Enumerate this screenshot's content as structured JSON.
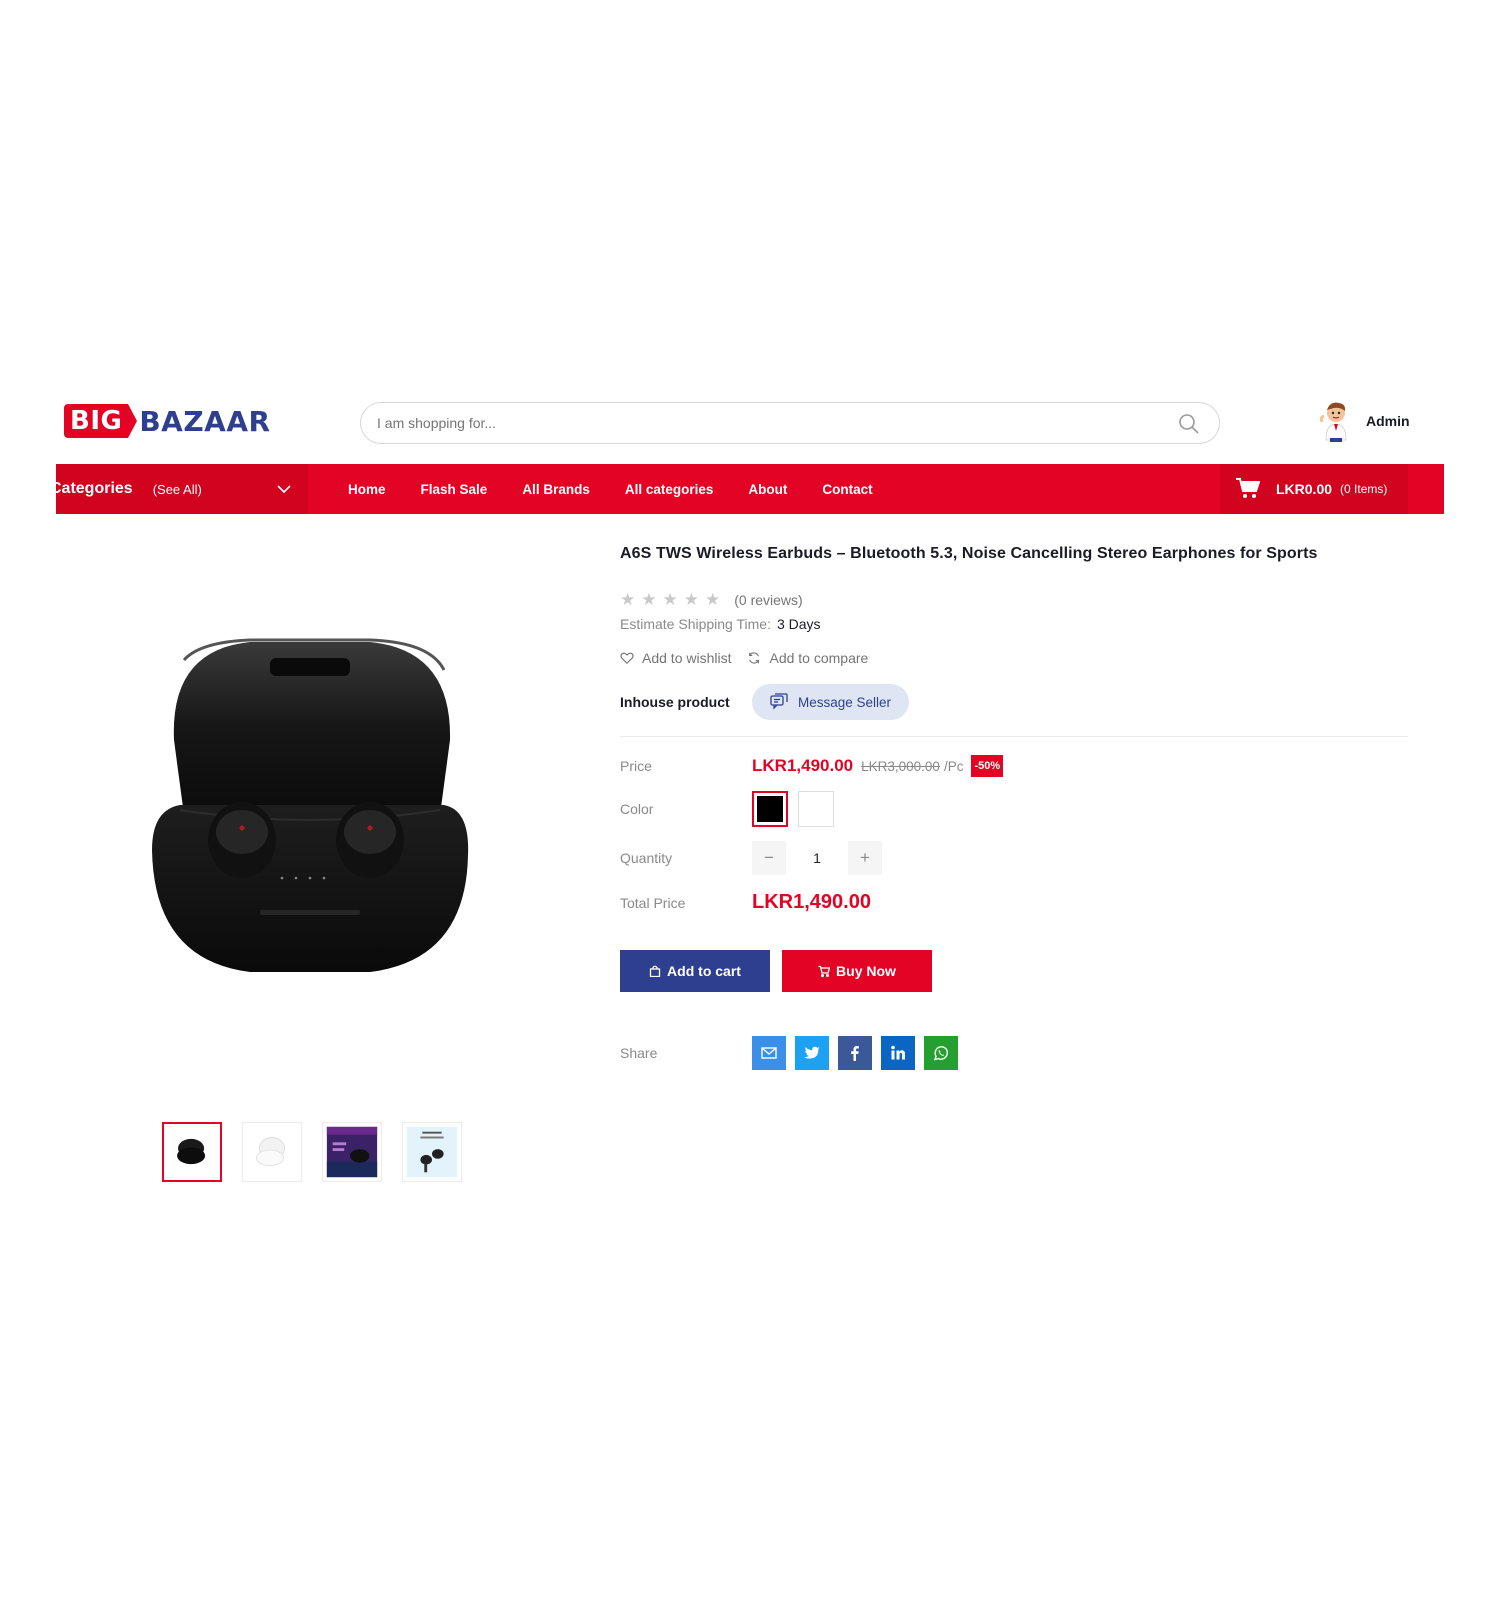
{
  "brand": {
    "logo_part1": "BIG",
    "logo_part2": "BAZAAR"
  },
  "search": {
    "placeholder": "I am shopping for..."
  },
  "user": {
    "name": "Admin"
  },
  "nav": {
    "categories_label": "Categories",
    "see_all": "(See All)",
    "items": [
      {
        "label": "Home"
      },
      {
        "label": "Flash Sale"
      },
      {
        "label": "All Brands"
      },
      {
        "label": "All categories"
      },
      {
        "label": "About"
      },
      {
        "label": "Contact"
      }
    ],
    "cart_total": "LKR0.00",
    "cart_items": "(0 Items)"
  },
  "product": {
    "title": "A6S TWS Wireless Earbuds – Bluetooth 5.3, Noise Cancelling Stereo Earphones for Sports",
    "reviews": "(0 reviews)",
    "rating": 0,
    "shipping_label": "Estimate Shipping Time:",
    "shipping_value": "3 Days",
    "wishlist": "Add to wishlist",
    "compare": "Add to compare",
    "inhouse": "Inhouse product",
    "message_seller": "Message Seller",
    "price_label": "Price",
    "price_now": "LKR1,490.00",
    "price_old": "LKR3,000.00",
    "unit": "/Pc",
    "discount": "-50%",
    "color_label": "Color",
    "colors": [
      "#000000",
      "#ffffff"
    ],
    "quantity_label": "Quantity",
    "quantity": "1",
    "qty_minus": "−",
    "qty_plus": "+",
    "total_label": "Total Price",
    "total": "LKR1,490.00",
    "add_to_cart": "Add to cart",
    "buy_now": "Buy Now",
    "share_label": "Share"
  },
  "colors": {
    "primary_red": "#e30425",
    "brand_blue": "#2e3f8f"
  },
  "share_icons": [
    "email-icon",
    "twitter-icon",
    "facebook-icon",
    "linkedin-icon",
    "whatsapp-icon"
  ]
}
